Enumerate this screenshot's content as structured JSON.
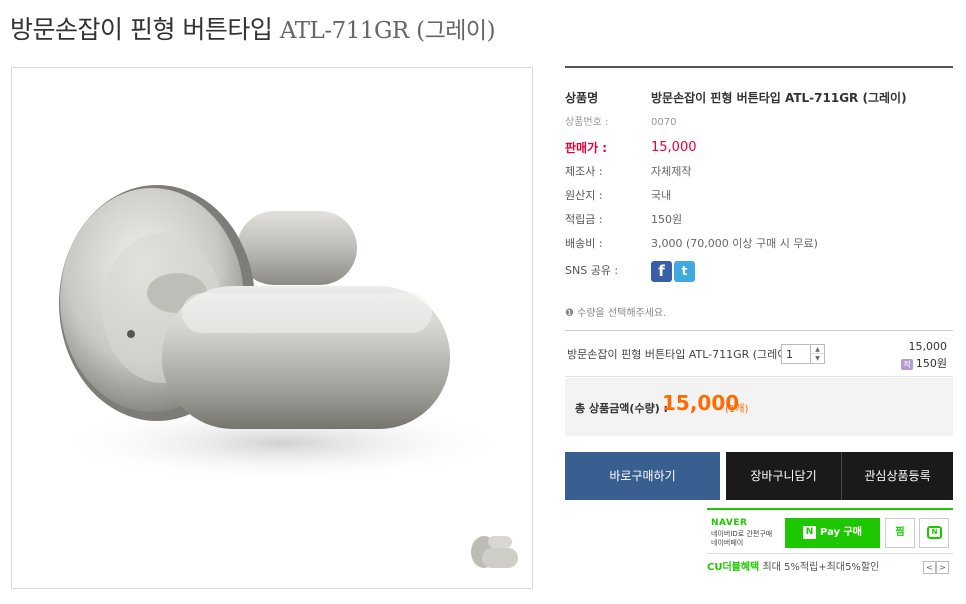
{
  "page_title": {
    "korean": "방문손잡이 핀형 버튼타입",
    "model": "ATL-711GR",
    "color": "(그레이)"
  },
  "image": {
    "alt_icon": "door-lever-handle"
  },
  "info": {
    "rows": [
      {
        "label": "상품명",
        "value": "방문손잡이 핀형 버튼타입 ATL-711GR (그레이)"
      },
      {
        "label": "상품번호 :",
        "value": "0070"
      },
      {
        "label": "판매가 :",
        "value": "15,000"
      },
      {
        "label": "제조사 :",
        "value": "자체제작"
      },
      {
        "label": "원산지 :",
        "value": "국내"
      },
      {
        "label": "적립금 :",
        "value": "150원"
      },
      {
        "label": "배송비 :",
        "value": "3,000 (70,000 이상 구매 시 무료)"
      },
      {
        "label": "SNS 공유 :",
        "value": ""
      }
    ],
    "sns": {
      "facebook": "f",
      "twitter": "t"
    },
    "notice": "❶ 수량을 선택해주세요."
  },
  "option": {
    "name": "방문손잡이 핀형 버튼타입 ATL-711GR (그레이)",
    "qty": "1",
    "price": "15,000",
    "point_badge": "적",
    "point": "150원"
  },
  "total": {
    "label": "총 상품금액(수량) :",
    "amount": "15,000",
    "count": "(1개)"
  },
  "buttons": {
    "buy": "바로구매하기",
    "cart": "장바구니담기",
    "wish": "관심상품등록"
  },
  "naver": {
    "logo": "NAVER",
    "desc1": "네이버ID로 간편구매",
    "desc2": "네이버페이",
    "pay_n": "N",
    "pay_label": "Pay 구매",
    "jjim": "찜",
    "talk": "N",
    "cu_label": "CU더블혜택",
    "cu_text": " 최대 5%적립+최대5%할인",
    "prev": "<",
    "next": ">"
  },
  "colors": {
    "price_red": "#e4003a",
    "total_orange": "#ff6b00",
    "buy_button": "#385f8f",
    "dark_button": "#1a1a1a",
    "naver_green": "#1ec800"
  }
}
